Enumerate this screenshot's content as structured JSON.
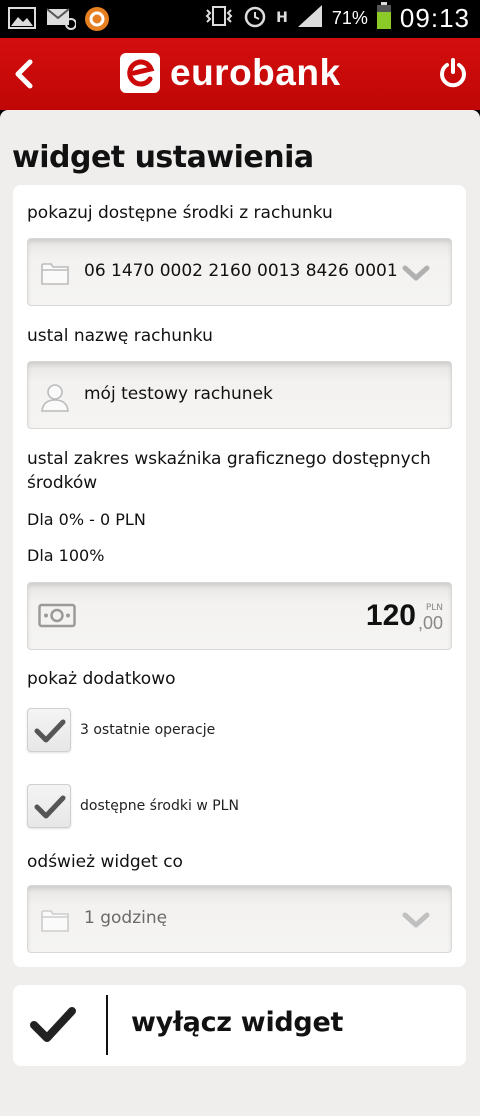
{
  "status_bar": {
    "battery_percent": "71%",
    "time": "09:13",
    "network_label": "H"
  },
  "header": {
    "brand": "eurobank",
    "accent_color": "#cc0a0a"
  },
  "page": {
    "title": "widget ustawienia"
  },
  "form": {
    "account_label": "pokazuj dostępne środki z rachunku",
    "account_value": "06 1470 0002 2160 0013 8426 0001",
    "name_label": "ustal nazwę rachunku",
    "name_value": "mój testowy rachunek",
    "range_label": "ustal zakres wskaźnika graficznego dostępnych środków",
    "range_min_text": "Dla 0% - 0 PLN",
    "range_max_text": "Dla 100%",
    "amount_main": "120",
    "amount_currency": "PLN",
    "amount_cents": ",00",
    "extra_label": "pokaż dodatkowo",
    "checkboxes": [
      {
        "label": "3 ostatnie operacje",
        "checked": true
      },
      {
        "label": "dostępne środki w PLN",
        "checked": true
      }
    ],
    "refresh_label": "odśwież widget co",
    "refresh_value": "1 godzinę"
  },
  "action": {
    "disable_label": "wyłącz widget"
  }
}
